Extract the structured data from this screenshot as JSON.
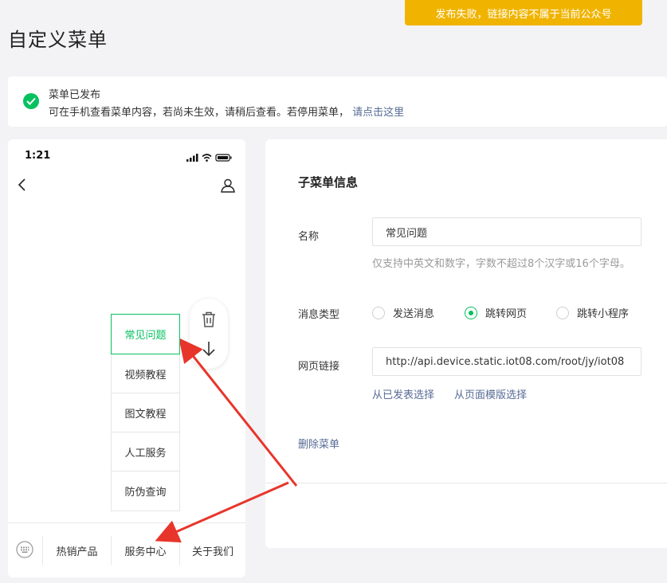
{
  "toast": {
    "text": "发布失败，链接内容不属于当前公众号"
  },
  "page": {
    "title": "自定义菜单"
  },
  "notice": {
    "title": "菜单已发布",
    "desc": "可在手机查看菜单内容，若尚未生效，请稍后查看。若停用菜单，",
    "link": "请点击这里"
  },
  "phone": {
    "time": "1:21",
    "submenu": [
      "常见问题",
      "视频教程",
      "图文教程",
      "人工服务",
      "防伪查询"
    ],
    "menu": [
      "热销产品",
      "服务中心",
      "关于我们"
    ]
  },
  "form": {
    "title": "子菜单信息",
    "name_label": "名称",
    "name_value": "常见问题",
    "name_hint": "仅支持中英文和数字，字数不超过8个汉字或16个字母。",
    "type_label": "消息类型",
    "types": [
      "发送消息",
      "跳转网页",
      "跳转小程序"
    ],
    "selected_type": "跳转网页",
    "url_label": "网页链接",
    "url_value": "http://api.device.static.iot08.com/root/jy/iot08",
    "link_published": "从已发表选择",
    "link_template": "从页面模版选择",
    "delete": "删除菜单"
  },
  "colors": {
    "accent": "#07c160",
    "warning": "#f0b400",
    "link": "#576b95",
    "annotation_arrow": "#e8352b"
  }
}
